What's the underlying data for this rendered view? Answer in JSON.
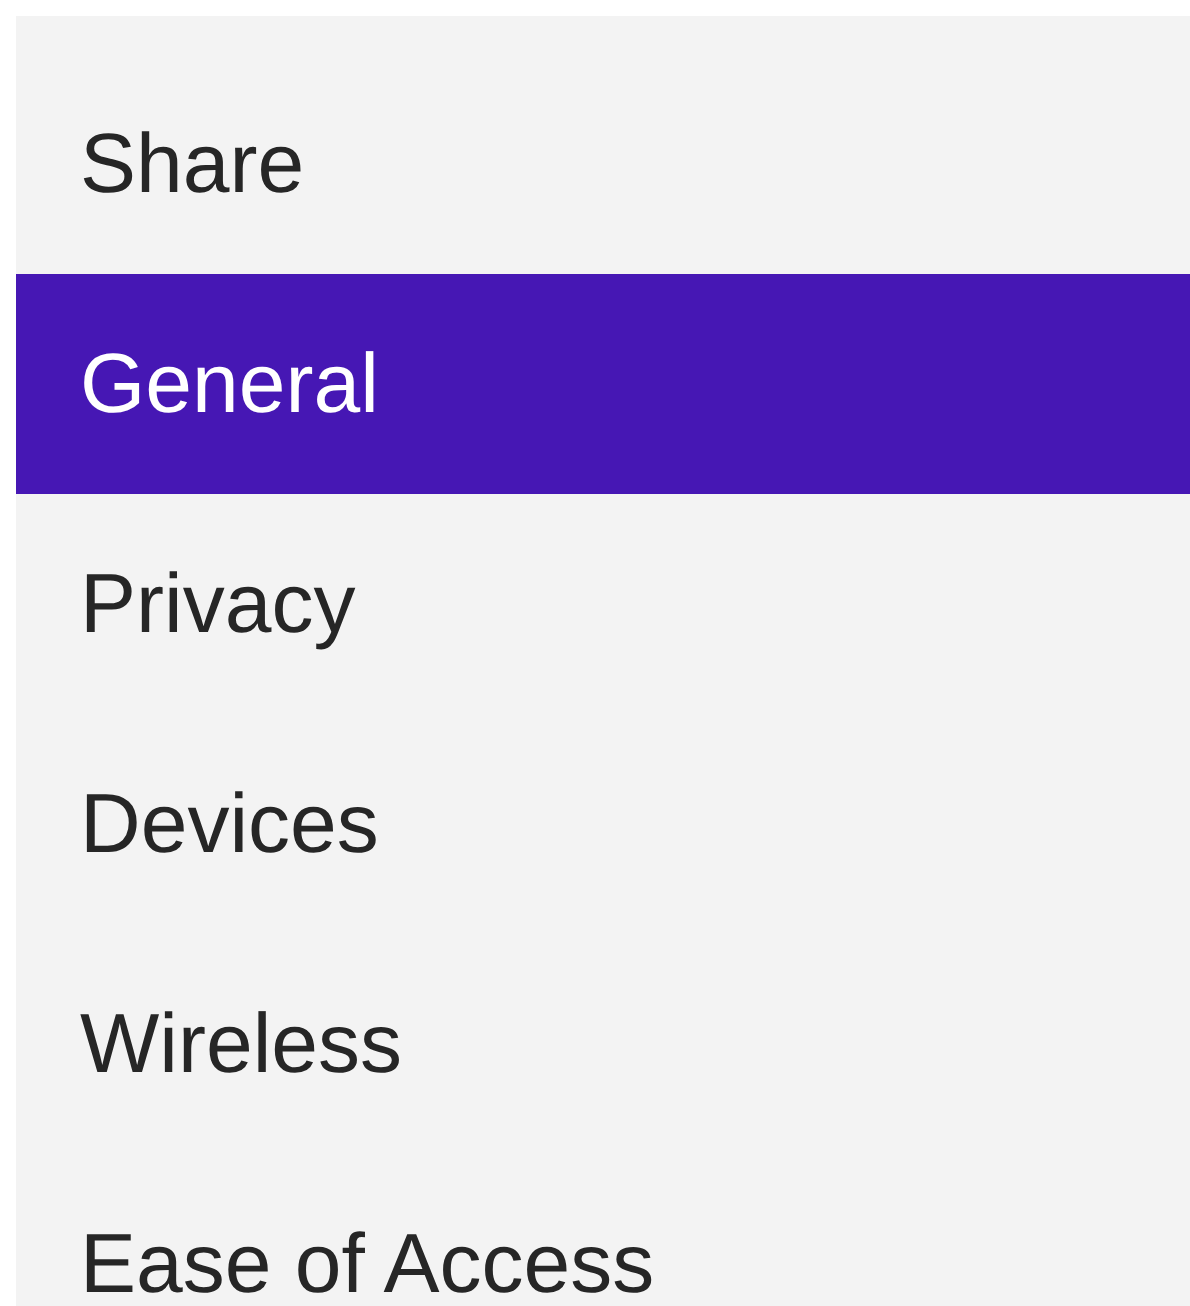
{
  "menu": {
    "items": [
      {
        "label": "Share",
        "selected": false
      },
      {
        "label": "General",
        "selected": true
      },
      {
        "label": "Privacy",
        "selected": false
      },
      {
        "label": "Devices",
        "selected": false
      },
      {
        "label": "Wireless",
        "selected": false
      },
      {
        "label": "Ease of Access",
        "selected": false
      }
    ]
  }
}
